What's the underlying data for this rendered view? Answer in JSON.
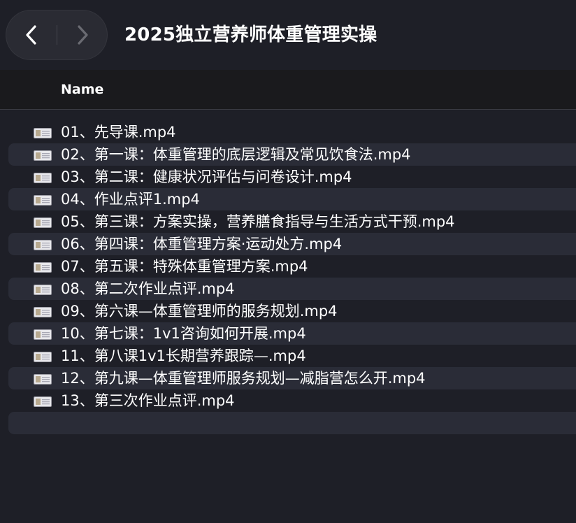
{
  "window": {
    "title": "2025独立营养师体重管理实操"
  },
  "navigation": {
    "back_icon": "chevron-left-icon",
    "forward_icon": "chevron-right-icon"
  },
  "columns": {
    "name_header": "Name"
  },
  "files": [
    {
      "name": "01、先导课.mp4",
      "icon": "video-file-icon"
    },
    {
      "name": "02、第一课：体重管理的底层逻辑及常见饮食法.mp4",
      "icon": "video-file-icon"
    },
    {
      "name": "03、第二课：健康状况评估与问卷设计.mp4",
      "icon": "video-file-icon"
    },
    {
      "name": "04、作业点评1.mp4",
      "icon": "video-file-icon"
    },
    {
      "name": "05、第三课：方案实操，营养膳食指导与生活方式干预.mp4",
      "icon": "video-file-icon"
    },
    {
      "name": "06、第四课：体重管理方案·运动处方.mp4",
      "icon": "video-file-icon"
    },
    {
      "name": "07、第五课：特殊体重管理方案.mp4",
      "icon": "video-file-icon"
    },
    {
      "name": "08、第二次作业点评.mp4",
      "icon": "video-file-icon"
    },
    {
      "name": "09、第六课—体重管理师的服务规划.mp4",
      "icon": "video-file-icon"
    },
    {
      "name": "10、第七课：1v1咨询如何开展.mp4",
      "icon": "video-file-icon"
    },
    {
      "name": "11、第八课1v1长期营养跟踪—.mp4",
      "icon": "video-file-icon"
    },
    {
      "name": "12、第九课—体重管理师服务规划—减脂营怎么开.mp4",
      "icon": "video-file-icon"
    },
    {
      "name": "13、第三次作业点评.mp4",
      "icon": "video-file-icon"
    }
  ],
  "colors": {
    "background": "#1e1f27",
    "header_background": "#1a1a1d",
    "alt_row": "#2a2c37",
    "text": "#ffffff"
  }
}
